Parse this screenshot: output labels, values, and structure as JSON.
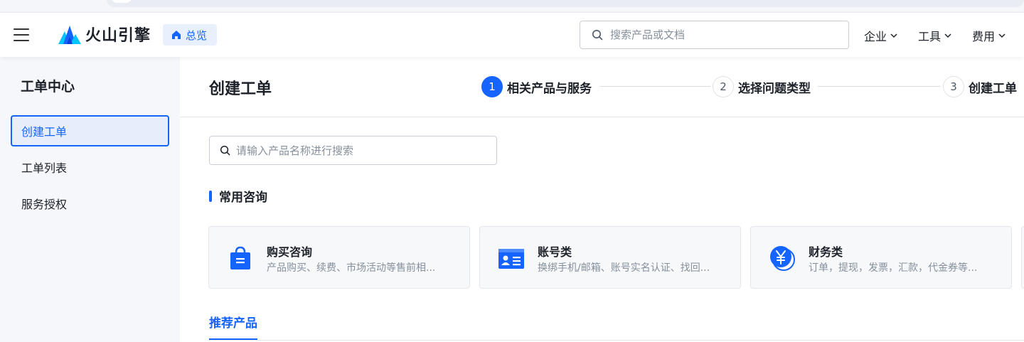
{
  "brand": {
    "name": "火山引擎"
  },
  "topnav": {
    "home_label": "总览",
    "search_placeholder": "搜索产品或文档",
    "menus": [
      {
        "label": "企业"
      },
      {
        "label": "工具"
      },
      {
        "label": "费用"
      }
    ]
  },
  "sidebar": {
    "title": "工单中心",
    "items": [
      {
        "label": "创建工单",
        "active": true
      },
      {
        "label": "工单列表",
        "active": false
      },
      {
        "label": "服务授权",
        "active": false
      }
    ]
  },
  "main": {
    "title": "创建工单",
    "steps": [
      {
        "num": "1",
        "label": "相关产品与服务",
        "active": true
      },
      {
        "num": "2",
        "label": "选择问题类型",
        "active": false
      },
      {
        "num": "3",
        "label": "创建工单",
        "active": false
      }
    ],
    "search_placeholder": "请输入产品名称进行搜索",
    "section_title": "常用咨询",
    "cards": [
      {
        "title": "购买咨询",
        "desc": "产品购买、续费、市场活动等售前相...",
        "icon": "shopping-bag-icon"
      },
      {
        "title": "账号类",
        "desc": "换绑手机/邮箱、账号实名认证、找回...",
        "icon": "id-card-icon"
      },
      {
        "title": "财务类",
        "desc": "订单，提现，发票，汇款，代金券等...",
        "icon": "yuan-coin-icon"
      }
    ],
    "tab_label": "推荐产品"
  },
  "colors": {
    "accent": "#1664ff",
    "sidebar_bg": "#f5f7fa",
    "card_bg": "#f7f8fa"
  }
}
